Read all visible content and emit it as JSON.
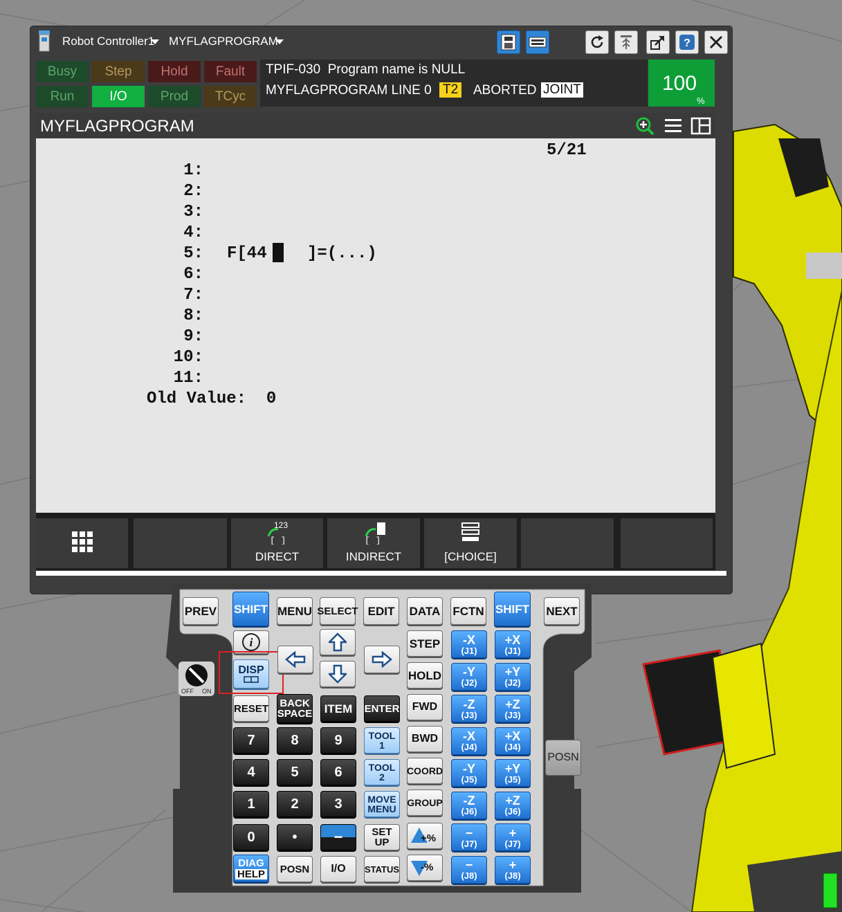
{
  "titlebar": {
    "controller": "Robot Controller1",
    "program": "MYFLAGPROGRAM"
  },
  "status_leds": [
    {
      "label": "Busy",
      "bg": "#1d4a2a",
      "fg": "#5aa66e"
    },
    {
      "label": "Step",
      "bg": "#4a3a1a",
      "fg": "#b59a5c"
    },
    {
      "label": "Hold",
      "bg": "#4a1a1a",
      "fg": "#c07070"
    },
    {
      "label": "Fault",
      "bg": "#4a1a1a",
      "fg": "#c07070"
    },
    {
      "label": "Run",
      "bg": "#1d4a2a",
      "fg": "#5aa66e"
    },
    {
      "label": "I/O",
      "bg": "#11b041",
      "fg": "#ffffff"
    },
    {
      "label": "Prod",
      "bg": "#1d4a2a",
      "fg": "#5aa66e"
    },
    {
      "label": "TCyc",
      "bg": "#4a3a1a",
      "fg": "#b59a5c"
    }
  ],
  "message": {
    "line1": "TPIF-030  Program name is NULL",
    "prog": "MYFLAGPROGRAM LINE 0",
    "mode": "T2",
    "state": "ABORTED",
    "coord": "JOINT"
  },
  "override": {
    "value": "100",
    "unit": "%"
  },
  "program_title": "MYFLAGPROGRAM",
  "screen": {
    "position": "5/21",
    "lines": [
      "1:",
      "2:",
      "3:",
      "4:",
      "5:",
      "6:",
      "7:",
      "8:",
      "9:",
      "10:",
      "11:"
    ],
    "instr_left": "F[44",
    "instr_right": "]=(...)",
    "old_value": "Old Value:  0"
  },
  "function_keys": [
    "",
    "",
    "DIRECT",
    "INDIRECT",
    "[CHOICE]",
    "",
    ""
  ],
  "fk_icon_text": {
    "direct": "123"
  },
  "keypad": {
    "prev": "PREV",
    "shift": "SHIFT",
    "menu": "MENU",
    "select": "SELECT",
    "edit": "EDIT",
    "data": "DATA",
    "fctn": "FCTN",
    "next": "NEXT",
    "info": "i",
    "disp": "DISP",
    "step": "STEP",
    "hold": "HOLD",
    "reset": "RESET",
    "back": "BACK",
    "space": "SPACE",
    "item": "ITEM",
    "enter": "ENTER",
    "fwd": "FWD",
    "bwd": "BWD",
    "coord": "COORD",
    "group": "GROUP",
    "tool": "TOOL",
    "tool1": "1",
    "tool2": "2",
    "move": "MOVE",
    "menu2": "MENU",
    "set": "SET",
    "up": "UP",
    "diag": "DIAG",
    "help": "HELP",
    "posn": "POSN",
    "io": "I/O",
    "status": "STATUS",
    "plus_pct": "+%",
    "minus_pct": "-%",
    "dot": "•",
    "minus": "−",
    "digits": [
      "7",
      "8",
      "9",
      "4",
      "5",
      "6",
      "1",
      "2",
      "3",
      "0"
    ],
    "jog": [
      {
        "a": "-X",
        "b": "(J1)"
      },
      {
        "a": "+X",
        "b": "(J1)"
      },
      {
        "a": "-Y",
        "b": "(J2)"
      },
      {
        "a": "+Y",
        "b": "(J2)"
      },
      {
        "a": "-Z",
        "b": "(J3)"
      },
      {
        "a": "+Z",
        "b": "(J3)"
      },
      {
        "a": "-X",
        "b": "(J4)"
      },
      {
        "a": "+X",
        "b": "(J4)"
      },
      {
        "a": "-Y",
        "b": "(J5)"
      },
      {
        "a": "+Y",
        "b": "(J5)"
      },
      {
        "a": "-Z",
        "b": "(J6)"
      },
      {
        "a": "+Z",
        "b": "(J6)"
      },
      {
        "a": "−",
        "b": "(J7)"
      },
      {
        "a": "+",
        "b": "(J7)"
      },
      {
        "a": "−",
        "b": "(J8)"
      },
      {
        "a": "+",
        "b": "(J8)"
      }
    ],
    "posn_side": "POSN",
    "off": "OFF",
    "on": "ON"
  },
  "colors": {
    "accent_blue": "#2f86d6",
    "override_green": "#0e9e37",
    "robot_yellow": "#e6e600",
    "highlight_red": "#e02020"
  }
}
